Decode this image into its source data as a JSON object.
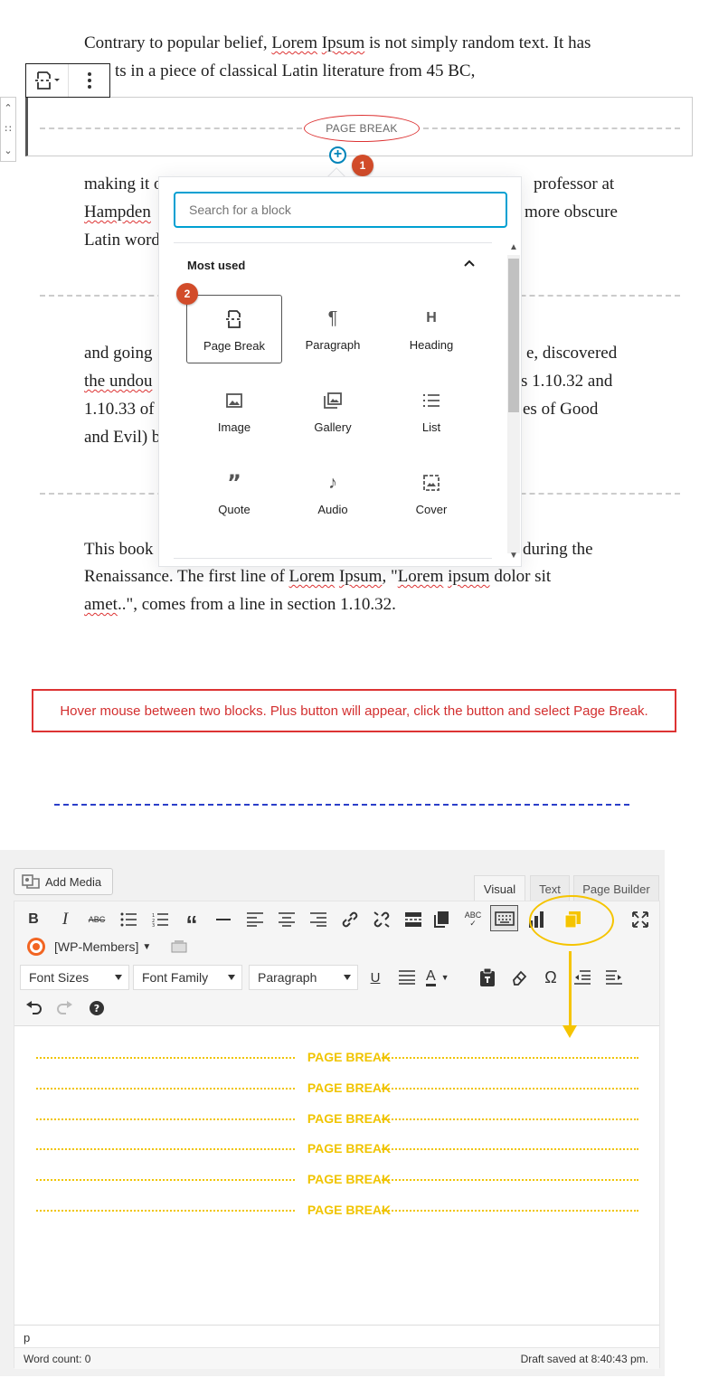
{
  "gutenberg": {
    "para1": [
      "Contrary to popular belief, ",
      "Lorem",
      " ",
      "Ipsum",
      " is not simply random text. It has",
      "ts in a piece of classical Latin literature from 45 BC,"
    ],
    "page_break_label": "PAGE BREAK",
    "badge1": "1",
    "badge2": "2",
    "para2_line1_left": "making it o",
    "para2_line1_right": "professor at",
    "para2_line2_left": "Hampden",
    "para2_line2_right": "more obscure",
    "para2_line3_left": "Latin word",
    "para3_lines_left": [
      "and going",
      "the undou",
      "1.10.33 of",
      "and Evil) b"
    ],
    "para3_lines_right": [
      "e, discovered",
      "s 1.10.32 and",
      "es of Good",
      ""
    ],
    "para4_line1_left": "This book",
    "para4_line1_right": "during the",
    "para4_line2": [
      "Renaissance. The first line of ",
      "Lorem",
      " ",
      "Ipsum",
      ", \"",
      "Lorem",
      " ",
      "ipsum",
      " dolor sit"
    ],
    "para4_line3": [
      "amet",
      "..\", comes from a line in section 1.10.32."
    ]
  },
  "inserter": {
    "search_placeholder": "Search for a block",
    "section_title": "Most used",
    "blocks": [
      {
        "label": "Page Break",
        "icon": "page-break-icon"
      },
      {
        "label": "Paragraph",
        "icon": "paragraph-icon"
      },
      {
        "label": "Heading",
        "icon": "heading-icon"
      },
      {
        "label": "Image",
        "icon": "image-icon"
      },
      {
        "label": "Gallery",
        "icon": "gallery-icon"
      },
      {
        "label": "List",
        "icon": "list-icon"
      },
      {
        "label": "Quote",
        "icon": "quote-icon"
      },
      {
        "label": "Audio",
        "icon": "audio-icon"
      },
      {
        "label": "Cover",
        "icon": "cover-icon"
      }
    ]
  },
  "hint": "Hover mouse between two blocks. Plus button will appear, click the button and select Page Break.",
  "classic": {
    "add_media": "Add Media",
    "tabs": [
      "Visual",
      "Text",
      "Page Builder"
    ],
    "wp_members": "[WP-Members]",
    "selects": [
      "Font Sizes",
      "Font Family",
      "Paragraph"
    ],
    "page_breaks": [
      "PAGE BREAK",
      "PAGE BREAK",
      "PAGE BREAK",
      "PAGE BREAK",
      "PAGE BREAK",
      "PAGE BREAK"
    ],
    "path": "p",
    "word_count": "Word count: 0",
    "draft_saved": "Draft saved at 8:40:43 pm."
  },
  "colors": {
    "accent_blue": "#00a0d2",
    "badge": "#d24c2a",
    "hint_red": "#d32f2f",
    "page_break_yellow": "#f0c400"
  }
}
